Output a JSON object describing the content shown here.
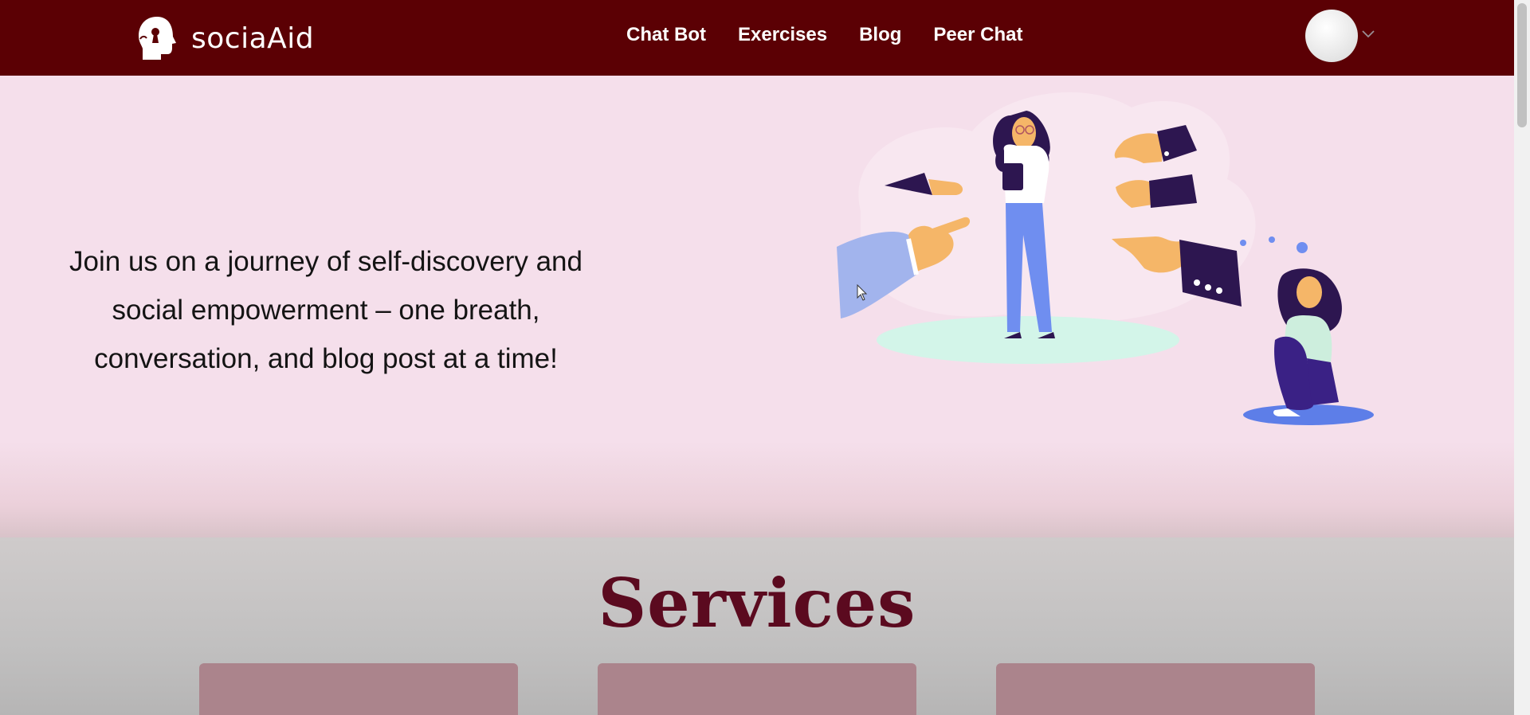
{
  "brand": {
    "name": "sociaAid",
    "logo_icon": "head-with-keyhole-icon"
  },
  "nav": {
    "links": [
      "Chat Bot",
      "Exercises",
      "Blog",
      "Peer Chat"
    ],
    "avatar_icon": "user-avatar",
    "dropdown_icon": "chevron-down-icon"
  },
  "hero": {
    "tagline_lines": [
      "Join us on a journey of self-discovery and",
      "social empowerment – one breath,",
      "conversation, and blog post at a time!"
    ],
    "illustration_icon": "pointing-hands-illustration"
  },
  "services": {
    "title": "Services",
    "card_count": 3
  },
  "colors": {
    "navbar": "#5b0004",
    "hero_bg": "#f5dfeb",
    "services_title": "#5b0a1f",
    "card": "#ab848c"
  }
}
